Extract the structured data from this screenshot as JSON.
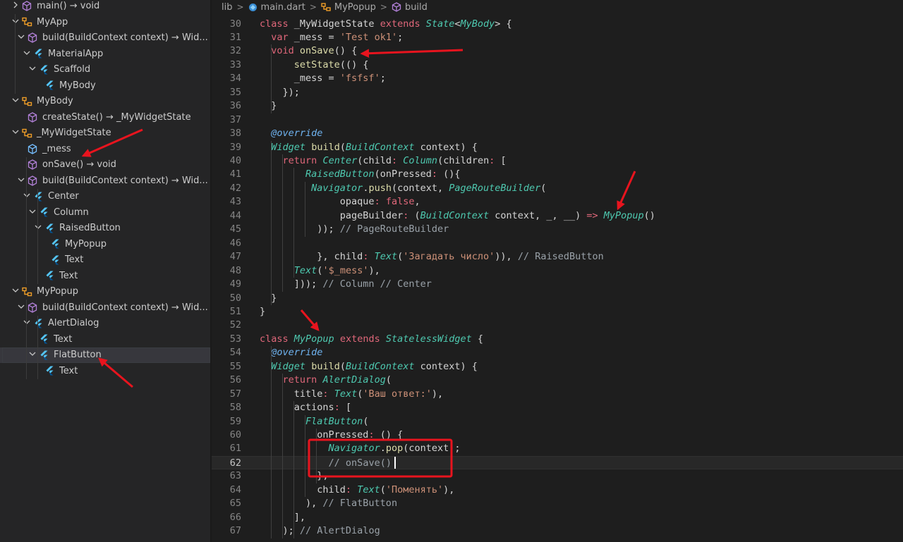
{
  "outline": {
    "items": [
      {
        "label": "main() → void",
        "icon": "method-icon",
        "twisty": ">"
      },
      {
        "label": "MyApp",
        "icon": "class-icon",
        "twisty": "v"
      },
      {
        "label": "build(BuildContext context) → Wid...",
        "icon": "method-icon",
        "twisty": "v"
      },
      {
        "label": "MaterialApp",
        "icon": "flutter-icon",
        "twisty": "v"
      },
      {
        "label": "Scaffold",
        "icon": "flutter-icon",
        "twisty": "v"
      },
      {
        "label": "MyBody",
        "icon": "flutter-icon",
        "twisty": ""
      },
      {
        "label": "MyBody",
        "icon": "class-icon",
        "twisty": "v"
      },
      {
        "label": "createState() → _MyWidgetState",
        "icon": "method-icon",
        "twisty": ""
      },
      {
        "label": "_MyWidgetState",
        "icon": "class-icon",
        "twisty": "v"
      },
      {
        "label": "_mess",
        "icon": "field-icon",
        "twisty": ""
      },
      {
        "label": "onSave() → void",
        "icon": "method-icon",
        "twisty": ""
      },
      {
        "label": "build(BuildContext context) → Wid...",
        "icon": "method-icon",
        "twisty": "v"
      },
      {
        "label": "Center",
        "icon": "flutter-icon",
        "twisty": "v"
      },
      {
        "label": "Column",
        "icon": "flutter-icon",
        "twisty": "v"
      },
      {
        "label": "RaisedButton",
        "icon": "flutter-icon",
        "twisty": "v"
      },
      {
        "label": "MyPopup",
        "icon": "flutter-icon",
        "twisty": ""
      },
      {
        "label": "Text",
        "icon": "flutter-icon",
        "twisty": ""
      },
      {
        "label": "Text",
        "icon": "flutter-icon",
        "twisty": ""
      },
      {
        "label": "MyPopup",
        "icon": "class-icon",
        "twisty": "v"
      },
      {
        "label": "build(BuildContext context) → Wid...",
        "icon": "method-icon",
        "twisty": "v"
      },
      {
        "label": "AlertDialog",
        "icon": "flutter-icon",
        "twisty": "v"
      },
      {
        "label": "Text",
        "icon": "flutter-icon",
        "twisty": ""
      },
      {
        "label": "FlatButton",
        "icon": "flutter-icon",
        "twisty": "v",
        "selected": true
      },
      {
        "label": "Text",
        "icon": "flutter-icon",
        "twisty": ""
      }
    ]
  },
  "breadcrumb": {
    "folder": "lib",
    "file": "main.dart",
    "class": "MyPopup",
    "method": "build"
  },
  "editor": {
    "current_line": "62",
    "lines": [
      {
        "n": "30",
        "t": "class _MyWidgetState extends State<MyBody> {"
      },
      {
        "n": "31",
        "t": "  var _mess = 'Test ok1';"
      },
      {
        "n": "32",
        "t": "  void onSave() {"
      },
      {
        "n": "33",
        "t": "      setState(() {"
      },
      {
        "n": "34",
        "t": "      _mess = 'fsfsf';"
      },
      {
        "n": "35",
        "t": "    });"
      },
      {
        "n": "36",
        "t": "  }"
      },
      {
        "n": "37",
        "t": ""
      },
      {
        "n": "38",
        "t": "  @override"
      },
      {
        "n": "39",
        "t": "  Widget build(BuildContext context) {"
      },
      {
        "n": "40",
        "t": "    return Center(child: Column(children: ["
      },
      {
        "n": "41",
        "t": "        RaisedButton(onPressed: (){"
      },
      {
        "n": "42",
        "t": "         Navigator.push(context, PageRouteBuilder("
      },
      {
        "n": "43",
        "t": "              opaque: false,"
      },
      {
        "n": "44",
        "t": "              pageBuilder: (BuildContext context, _, __) => MyPopup()"
      },
      {
        "n": "45",
        "t": "          )); // PageRouteBuilder"
      },
      {
        "n": "46",
        "t": ""
      },
      {
        "n": "47",
        "t": "          }, child: Text('Загадать число')), // RaisedButton"
      },
      {
        "n": "48",
        "t": "      Text('$_mess'),"
      },
      {
        "n": "49",
        "t": "      ])); // Column // Center"
      },
      {
        "n": "50",
        "t": "  }"
      },
      {
        "n": "51",
        "t": "}"
      },
      {
        "n": "52",
        "t": ""
      },
      {
        "n": "53",
        "t": "class MyPopup extends StatelessWidget {"
      },
      {
        "n": "54",
        "t": "  @override"
      },
      {
        "n": "55",
        "t": "  Widget build(BuildContext context) {"
      },
      {
        "n": "56",
        "t": "    return AlertDialog("
      },
      {
        "n": "57",
        "t": "      title: Text('Ваш ответ:'),"
      },
      {
        "n": "58",
        "t": "      actions: ["
      },
      {
        "n": "59",
        "t": "        FlatButton("
      },
      {
        "n": "60",
        "t": "          onPressed: () {"
      },
      {
        "n": "61",
        "t": "            Navigator.pop(context);"
      },
      {
        "n": "62",
        "t": "            // onSave()"
      },
      {
        "n": "63",
        "t": "          },"
      },
      {
        "n": "64",
        "t": "          child: Text('Поменять'),"
      },
      {
        "n": "65",
        "t": "        ), // FlatButton"
      },
      {
        "n": "66",
        "t": "      ],"
      },
      {
        "n": "67",
        "t": "    ); // AlertDialog"
      }
    ]
  },
  "colors": {
    "annotation_arrow": "#e8141e",
    "highlight_box": "#e8141e",
    "sidebar_bg": "#252526",
    "editor_bg": "#1e1e1e"
  }
}
